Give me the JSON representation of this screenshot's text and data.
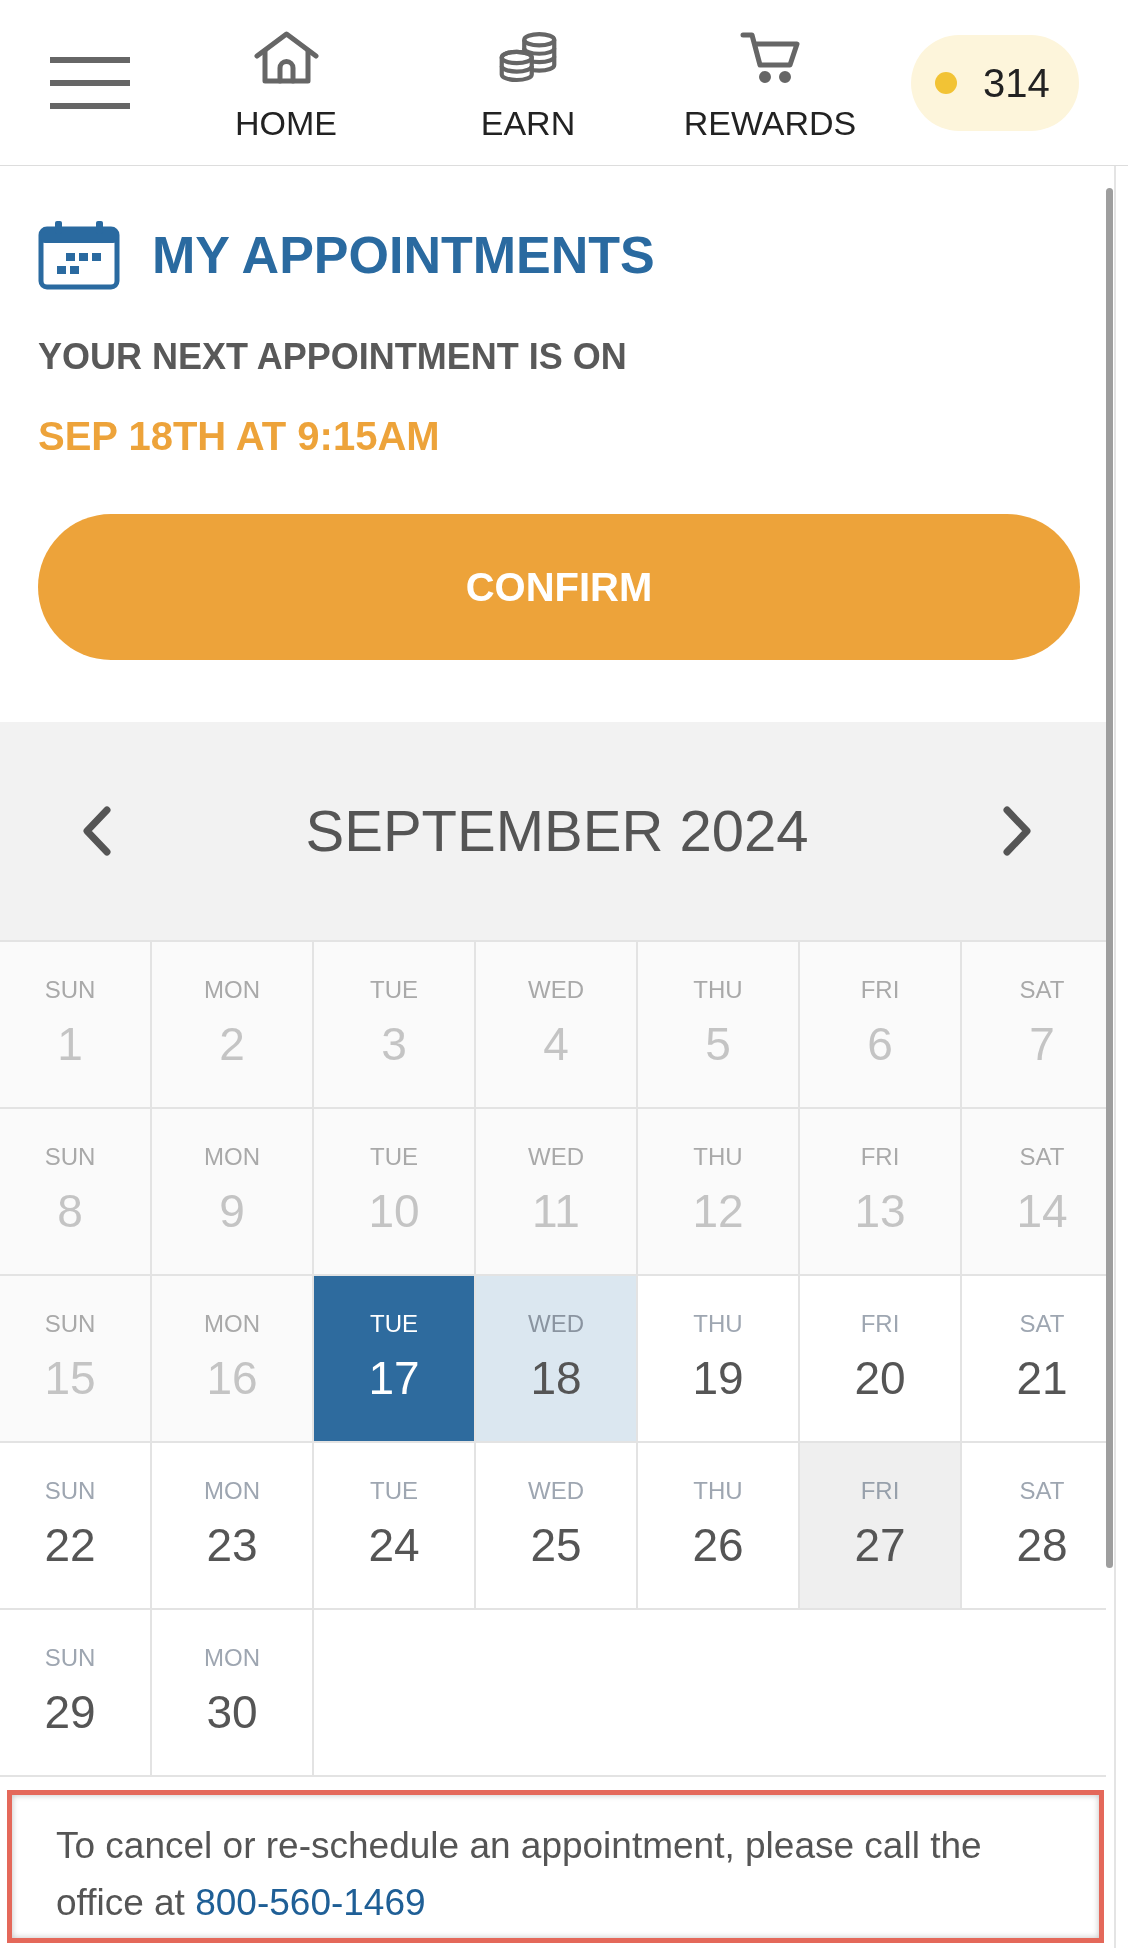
{
  "nav": {
    "items": [
      {
        "label": "HOME"
      },
      {
        "label": "EARN"
      },
      {
        "label": "REWARDS"
      }
    ],
    "points": "314"
  },
  "appointments": {
    "title": "MY APPOINTMENTS",
    "subtitle": "YOUR NEXT APPOINTMENT IS ON",
    "next_date": "SEP 18TH AT 9:15AM",
    "confirm_button": "CONFIRM"
  },
  "calendar": {
    "month": "SEPTEMBER 2024",
    "days": [
      {
        "weekday": "SUN",
        "date": "1",
        "kind": "past",
        "selected": false
      },
      {
        "weekday": "MON",
        "date": "2",
        "kind": "past",
        "selected": false
      },
      {
        "weekday": "TUE",
        "date": "3",
        "kind": "past",
        "selected": false
      },
      {
        "weekday": "WED",
        "date": "4",
        "kind": "past",
        "selected": false
      },
      {
        "weekday": "THU",
        "date": "5",
        "kind": "past",
        "selected": false
      },
      {
        "weekday": "FRI",
        "date": "6",
        "kind": "past",
        "selected": false
      },
      {
        "weekday": "SAT",
        "date": "7",
        "kind": "past",
        "selected": false
      },
      {
        "weekday": "SUN",
        "date": "8",
        "kind": "past",
        "selected": false
      },
      {
        "weekday": "MON",
        "date": "9",
        "kind": "past",
        "selected": false
      },
      {
        "weekday": "TUE",
        "date": "10",
        "kind": "past",
        "selected": false
      },
      {
        "weekday": "WED",
        "date": "11",
        "kind": "past",
        "selected": false
      },
      {
        "weekday": "THU",
        "date": "12",
        "kind": "past",
        "selected": false
      },
      {
        "weekday": "FRI",
        "date": "13",
        "kind": "past",
        "selected": false
      },
      {
        "weekday": "SAT",
        "date": "14",
        "kind": "past",
        "selected": false
      },
      {
        "weekday": "SUN",
        "date": "15",
        "kind": "past",
        "selected": false
      },
      {
        "weekday": "MON",
        "date": "16",
        "kind": "past",
        "selected": false
      },
      {
        "weekday": "TUE",
        "date": "17",
        "kind": "open",
        "selected": true
      },
      {
        "weekday": "WED",
        "date": "18",
        "kind": "appointment",
        "selected": false
      },
      {
        "weekday": "THU",
        "date": "19",
        "kind": "open",
        "selected": false
      },
      {
        "weekday": "FRI",
        "date": "20",
        "kind": "open",
        "selected": false
      },
      {
        "weekday": "SAT",
        "date": "21",
        "kind": "open",
        "selected": false
      },
      {
        "weekday": "SUN",
        "date": "22",
        "kind": "open",
        "selected": false
      },
      {
        "weekday": "MON",
        "date": "23",
        "kind": "open",
        "selected": false
      },
      {
        "weekday": "TUE",
        "date": "24",
        "kind": "open",
        "selected": false
      },
      {
        "weekday": "WED",
        "date": "25",
        "kind": "open",
        "selected": false
      },
      {
        "weekday": "THU",
        "date": "26",
        "kind": "open",
        "selected": false
      },
      {
        "weekday": "FRI",
        "date": "27",
        "kind": "closed",
        "selected": false
      },
      {
        "weekday": "SAT",
        "date": "28",
        "kind": "open",
        "selected": false
      },
      {
        "weekday": "SUN",
        "date": "29",
        "kind": "open",
        "selected": false
      },
      {
        "weekday": "MON",
        "date": "30",
        "kind": "open",
        "selected": false
      }
    ]
  },
  "notice": {
    "text": "To cancel or re-schedule an appointment, please call the office at",
    "phone": "800-560-1469"
  }
}
